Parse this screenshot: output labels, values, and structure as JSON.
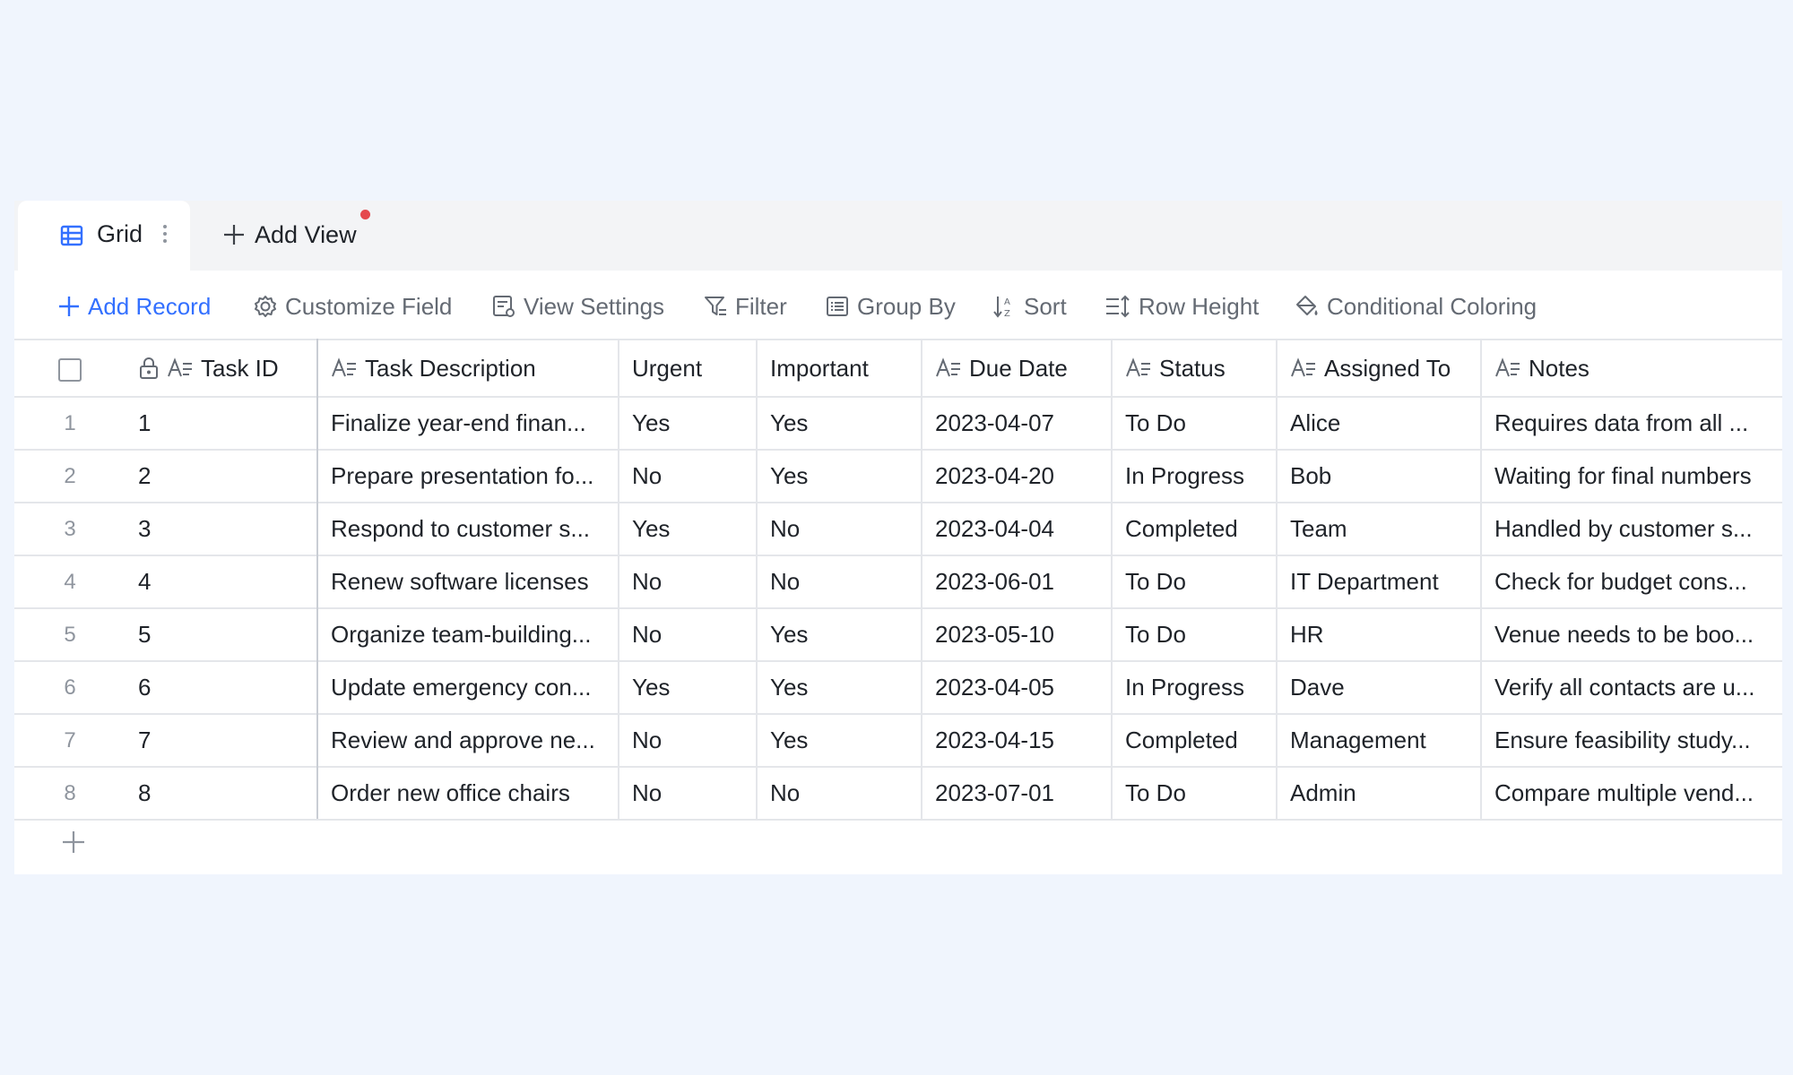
{
  "tabs": {
    "grid_label": "Grid",
    "add_view_label": "Add View"
  },
  "toolbar": {
    "add_record": "Add Record",
    "customize_field": "Customize Field",
    "view_settings": "View Settings",
    "filter": "Filter",
    "group_by": "Group By",
    "sort": "Sort",
    "row_height": "Row Height",
    "conditional_coloring": "Conditional Coloring"
  },
  "columns": [
    "Task ID",
    "Task Description",
    "Urgent",
    "Important",
    "Due Date",
    "Status",
    "Assigned To",
    "Notes"
  ],
  "rows": [
    {
      "index": "1",
      "task_id": "1",
      "description": "Finalize year-end finan...",
      "urgent": "Yes",
      "important": "Yes",
      "due_date": "2023-04-07",
      "status": "To Do",
      "assigned_to": "Alice",
      "notes": "Requires data from all ..."
    },
    {
      "index": "2",
      "task_id": "2",
      "description": "Prepare presentation fo...",
      "urgent": "No",
      "important": "Yes",
      "due_date": "2023-04-20",
      "status": "In Progress",
      "assigned_to": "Bob",
      "notes": "Waiting for final numbers"
    },
    {
      "index": "3",
      "task_id": "3",
      "description": "Respond to customer s...",
      "urgent": "Yes",
      "important": "No",
      "due_date": "2023-04-04",
      "status": "Completed",
      "assigned_to": "Team",
      "notes": "Handled by customer s..."
    },
    {
      "index": "4",
      "task_id": "4",
      "description": "Renew software licenses",
      "urgent": "No",
      "important": "No",
      "due_date": "2023-06-01",
      "status": "To Do",
      "assigned_to": "IT Department",
      "notes": "Check for budget cons..."
    },
    {
      "index": "5",
      "task_id": "5",
      "description": "Organize team-building...",
      "urgent": "No",
      "important": "Yes",
      "due_date": "2023-05-10",
      "status": "To Do",
      "assigned_to": "HR",
      "notes": "Venue needs to be boo..."
    },
    {
      "index": "6",
      "task_id": "6",
      "description": "Update emergency con...",
      "urgent": "Yes",
      "important": "Yes",
      "due_date": "2023-04-05",
      "status": "In Progress",
      "assigned_to": "Dave",
      "notes": "Verify all contacts are u..."
    },
    {
      "index": "7",
      "task_id": "7",
      "description": "Review and approve ne...",
      "urgent": "No",
      "important": "Yes",
      "due_date": "2023-04-15",
      "status": "Completed",
      "assigned_to": "Management",
      "notes": "Ensure feasibility study..."
    },
    {
      "index": "8",
      "task_id": "8",
      "description": "Order new office chairs",
      "urgent": "No",
      "important": "No",
      "due_date": "2023-07-01",
      "status": "To Do",
      "assigned_to": "Admin",
      "notes": "Compare multiple vend..."
    }
  ],
  "icons": {
    "grid_tab": "grid-view-icon",
    "tab_more": "more-vertical-icon",
    "add_view": "plus-icon",
    "add_record": "plus-icon",
    "customize_field": "gear-icon",
    "view_settings": "view-settings-icon",
    "filter": "filter-icon",
    "group_by": "group-by-icon",
    "sort": "sort-icon",
    "row_height": "row-height-icon",
    "conditional_coloring": "paint-bucket-icon",
    "lock": "lock-icon",
    "text_field": "text-field-icon",
    "add_row": "plus-icon"
  },
  "colors": {
    "accent": "#3370ff",
    "notification_dot": "#e5484d",
    "page_background": "#f0f5fd"
  }
}
